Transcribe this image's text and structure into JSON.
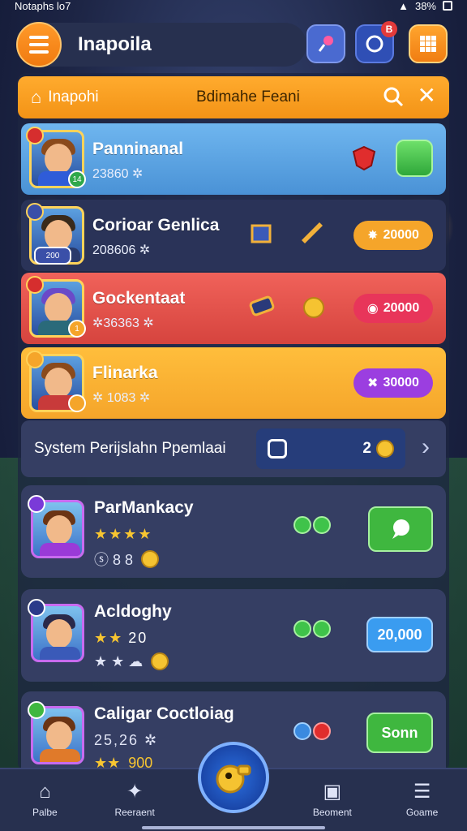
{
  "status_bar": {
    "left": "Notaphs lo7",
    "right": "38%"
  },
  "app_bar": {
    "title": "Inapoila",
    "notify_badge": "B"
  },
  "header": {
    "title": "Inapohi",
    "subtitle": "Bdimahe Feani"
  },
  "players": [
    {
      "name": "Panninanal",
      "meta": "23860 ✲",
      "level": "14",
      "style": "blue"
    },
    {
      "name": "Corioar Genlica",
      "meta": "208606 ✲",
      "level": "200",
      "value": "20000",
      "value_color": "#f5a52a"
    },
    {
      "name": "Gockentaat",
      "meta": "✲36363 ✲",
      "level": "1",
      "value": "20000",
      "value_color": "#e8355a"
    },
    {
      "name": "Flinarka",
      "meta": "✲ 1083 ✲",
      "level": "",
      "value": "30000",
      "value_color": "#9b3ee0"
    }
  ],
  "system_row": {
    "label": "System Perijslahn Ppemlaai",
    "count": "2"
  },
  "cards": [
    {
      "name": "ParMankacy",
      "stars": "★★★★",
      "rating": "",
      "extras": "ⓢ 8 8",
      "action": "",
      "action_color": "#3fb73f"
    },
    {
      "name": "Acldoghy",
      "stars": "★★",
      "rating": "20",
      "extras": "★ ★ ☁",
      "action": "20,000",
      "action_color": "#3a9cf0"
    },
    {
      "name": "Caligar Coctloiag",
      "stars": "★★",
      "rating": "900",
      "extras": "25,26 ✲",
      "action": "Sonn",
      "action_color": "#3fb73f"
    }
  ],
  "nav": [
    {
      "label": "Palbe",
      "icon": "home-icon"
    },
    {
      "label": "Reeraent",
      "icon": "emblem-icon"
    },
    {
      "label": "Beoment",
      "icon": "inbox-icon"
    },
    {
      "label": "Goame",
      "icon": "menu-icon"
    }
  ]
}
